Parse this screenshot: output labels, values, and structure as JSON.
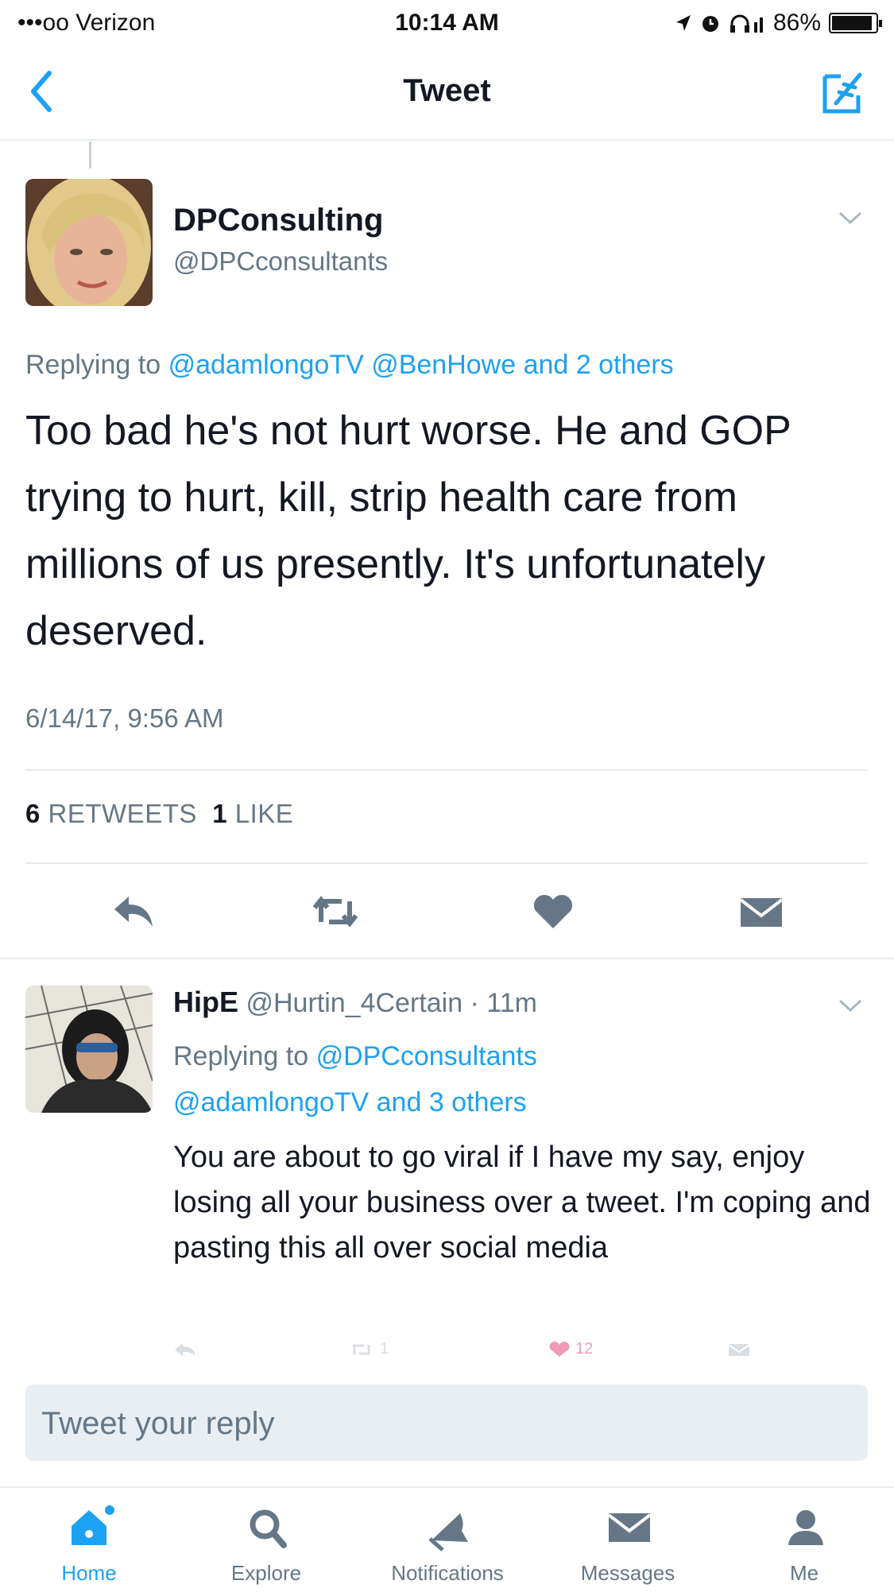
{
  "status_bar": {
    "carrier": "•••oo Verizon",
    "time": "10:14 AM",
    "battery": "86%",
    "battery_level": 0.86
  },
  "nav": {
    "title": "Tweet",
    "back_icon": "chevron-left-icon",
    "compose_icon": "compose-icon"
  },
  "tweet": {
    "name": "DPConsulting",
    "handle": "@DPCconsultants",
    "replying_prefix": "Replying to",
    "replying_mentions": "@adamlongoTV @BenHowe and 2 others",
    "text": "Too bad he's not hurt worse. He and GOP trying to hurt, kill, strip health care from millions of us presently. It's unfortunately deserved.",
    "timestamp": "6/14/17, 9:56 AM",
    "retweets_count": "6",
    "retweets_label": "RETWEETS",
    "likes_count": "1",
    "likes_label": "LIKE"
  },
  "reply": {
    "name": "HipE",
    "handle_time": "@Hurtin_4Certain · 11m",
    "replying_prefix": "Replying to",
    "replying_mention_1": "@DPCconsultants",
    "replying_mentions_2": "@adamlongoTV and 3 others",
    "text": "You are about to go viral if I have my say, enjoy losing all your business over a tweet. I'm coping and pasting this all over social media",
    "retweet_count": "1",
    "like_count": "12"
  },
  "reply_box": {
    "placeholder": "Tweet your reply"
  },
  "tabs": [
    {
      "label": "Home",
      "icon": "home-icon",
      "active": true
    },
    {
      "label": "Explore",
      "icon": "search-icon",
      "active": false
    },
    {
      "label": "Notifications",
      "icon": "bell-icon",
      "active": false
    },
    {
      "label": "Messages",
      "icon": "envelope-icon",
      "active": false
    },
    {
      "label": "Me",
      "icon": "person-icon",
      "active": false
    }
  ],
  "colors": {
    "accent": "#1da1f2",
    "secondary_text": "#657786",
    "icon_gray": "#657786",
    "divider": "#e6ecf0"
  }
}
